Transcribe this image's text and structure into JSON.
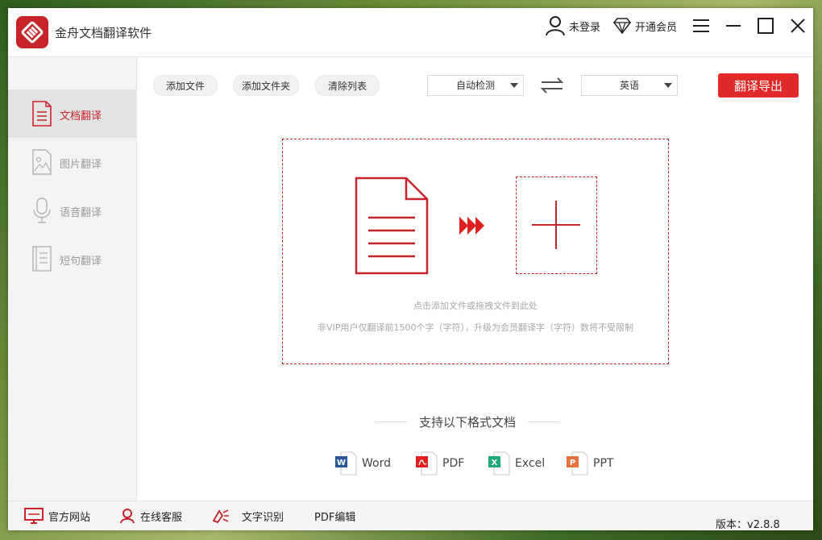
{
  "app": {
    "title": "金舟文档翻译软件"
  },
  "titlebar": {
    "login_label": "未登录",
    "vip_label": "开通会员"
  },
  "sidebar": {
    "items": [
      {
        "label": "文档翻译",
        "icon": "document-icon",
        "active": true
      },
      {
        "label": "图片翻译",
        "icon": "image-icon",
        "active": false
      },
      {
        "label": "语音翻译",
        "icon": "microphone-icon",
        "active": false
      },
      {
        "label": "短句翻译",
        "icon": "notebook-icon",
        "active": false
      }
    ]
  },
  "toolbar": {
    "add_file": "添加文件",
    "add_folder": "添加文件夹",
    "clear_list": "清除列表",
    "source_lang": "自动检测",
    "target_lang": "英语",
    "translate_export": "翻译导出"
  },
  "dropzone": {
    "hint": "点击添加文件或拖拽文件到此处",
    "limit_note": "非VIP用户仅翻译前1500个字（字符），升级为会员翻译字（字符）数将不受限制"
  },
  "formats": {
    "heading": "支持以下格式文档",
    "items": [
      {
        "label": "Word",
        "icon": "word-icon",
        "color": "#2b579a"
      },
      {
        "label": "PDF",
        "icon": "pdf-icon",
        "color": "#e02020"
      },
      {
        "label": "Excel",
        "icon": "excel-icon",
        "color": "#1fa87a"
      },
      {
        "label": "PPT",
        "icon": "ppt-icon",
        "color": "#e8713c"
      }
    ]
  },
  "footer": {
    "website": "官方网站",
    "support": "在线客服",
    "ocr": "文字识别",
    "pdf_edit": "PDF编辑",
    "version": "版本：v2.8.8"
  },
  "colors": {
    "accent": "#c8232b",
    "button": "#e02a2a"
  }
}
